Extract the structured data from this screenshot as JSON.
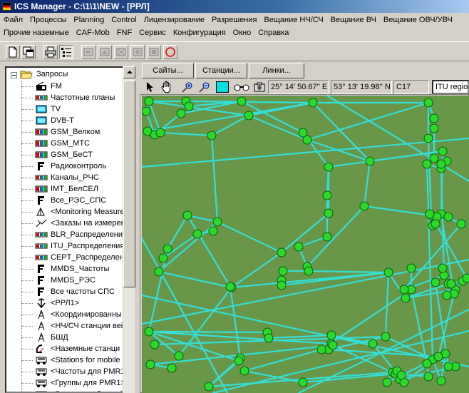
{
  "window": {
    "title": "ICS Manager - C:\\1\\1\\NEW - [РРЛ]"
  },
  "menu": {
    "row1": [
      "Файл",
      "Процессы",
      "Planning",
      "Control",
      "Лицензирование",
      "Разрешения",
      "Вещание НЧ/СЧ",
      "Вещание ВЧ",
      "Вещание ОВЧ/УВЧ"
    ],
    "row2": [
      "Прочие наземные",
      "CAF-Mob",
      "FNF",
      "Сервис",
      "Конфигурация",
      "Окно",
      "Справка"
    ]
  },
  "toolbar": {
    "icons": [
      "new-document-icon",
      "copy-window-icon",
      "print-icon",
      "tree-view-icon",
      "tool-1-icon",
      "tool-2-icon",
      "tool-3-icon",
      "tool-4-icon",
      "tool-5-icon",
      "circle-icon"
    ]
  },
  "tree": {
    "root": "Запросы",
    "items": [
      {
        "label": "FM",
        "icon": "radio-icon"
      },
      {
        "label": "Частотные планы",
        "icon": "plan-icon"
      },
      {
        "label": "TV",
        "icon": "tv-icon"
      },
      {
        "label": "DVB-T",
        "icon": "tv-icon"
      },
      {
        "label": "GSM_Велком",
        "icon": "gsm-icon"
      },
      {
        "label": "GSM_МТС",
        "icon": "gsm-icon"
      },
      {
        "label": "GSM_БеСТ",
        "icon": "gsm-icon"
      },
      {
        "label": "Радиоконтроль",
        "icon": "frequency-icon"
      },
      {
        "label": "Каналы_РЧС",
        "icon": "plan-icon"
      },
      {
        "label": "IMT_БелСЕЛ",
        "icon": "gsm-icon"
      },
      {
        "label": "Все_РЭС_СПС",
        "icon": "frequency-icon"
      },
      {
        "label": "<Monitoring Measure",
        "icon": "measure-icon"
      },
      {
        "label": "<Заказы на измерен",
        "icon": "order-icon"
      },
      {
        "label": "BLR_Распределения",
        "icon": "plan-icon"
      },
      {
        "label": "ITU_Распределения",
        "icon": "plan-icon"
      },
      {
        "label": "CEPT_Распределени",
        "icon": "plan-icon"
      },
      {
        "label": "MMDS_Частоты",
        "icon": "frequency-icon"
      },
      {
        "label": "MMDS_РЭС",
        "icon": "frequency-icon"
      },
      {
        "label": "Все частоты СПС",
        "icon": "frequency-icon"
      },
      {
        "label": "<РРЛ1>",
        "icon": "rrl-icon"
      },
      {
        "label": "<Координированны",
        "icon": "tower-icon"
      },
      {
        "label": "<НЧ/СЧ станции веі",
        "icon": "tower-icon"
      },
      {
        "label": "БШД",
        "icon": "tower-icon"
      },
      {
        "label": "<Наземные станци",
        "icon": "satellite-icon"
      },
      {
        "label": "<Stations for mobile (",
        "icon": "mobile-icon"
      },
      {
        "label": "<Частоты для PMR1",
        "icon": "mobile-icon"
      },
      {
        "label": "<Группы для PMR1>",
        "icon": "mobile-icon"
      },
      {
        "label": "<Группы сообщений",
        "icon": "mobile-icon"
      }
    ]
  },
  "tabs": [
    "Сайты...",
    "Станции...",
    "Линки..."
  ],
  "map_toolbar": {
    "icons": [
      "pointer-icon",
      "hand-icon",
      "zoom-in-icon",
      "zoom-out-icon",
      "fill-square-icon",
      "binoculars-icon",
      "camera-icon"
    ],
    "longitude": "25° 14' 50.67'' E",
    "latitude": "53° 13' 19.98'' N",
    "code": "C17",
    "region": "ITU region"
  },
  "colors": {
    "map_background": "#6a964a",
    "links": "#33e0d8",
    "stations": "#2bd82b",
    "title_bar": "#0a246a"
  }
}
